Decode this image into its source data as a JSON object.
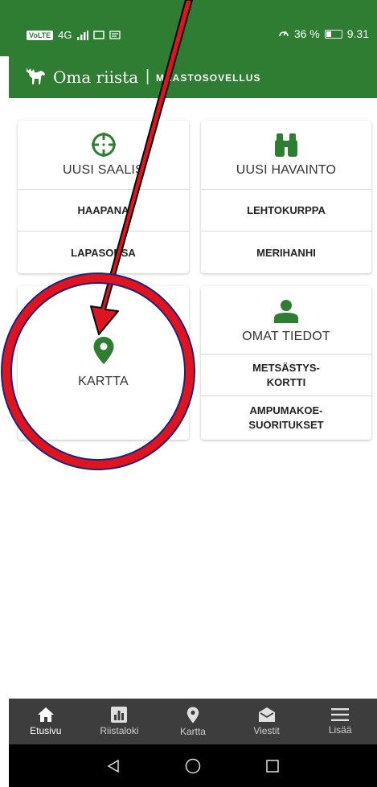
{
  "status": {
    "network": "4G",
    "battery": "36 %",
    "time": "9.31",
    "battery_level": 0.36
  },
  "app": {
    "title": "Oma riista",
    "subtitle": "MAASTOSOVELLUS"
  },
  "cards": {
    "saalis": {
      "title": "UUSI SAALIS",
      "items": [
        "HAAPANA",
        "LAPASORSA"
      ]
    },
    "havainto": {
      "title": "UUSI HAVAINTO",
      "items": [
        "LEHTOKURPPA",
        "MERIHANHI"
      ]
    },
    "kartta": {
      "title": "KARTTA"
    },
    "omat": {
      "title": "OMAT TIEDOT",
      "items": [
        "METSÄSTYS-\nKORTTI",
        "AMPUMAKOE-\nSUORITUKSET"
      ]
    }
  },
  "bottom_nav": [
    {
      "label": "Etusivu",
      "icon": "home-icon"
    },
    {
      "label": "Riistaloki",
      "icon": "bar-chart-icon"
    },
    {
      "label": "Kartta",
      "icon": "map-pin-icon"
    },
    {
      "label": "Viestit",
      "icon": "mail-icon"
    },
    {
      "label": "Lisää",
      "icon": "menu-icon"
    }
  ],
  "colors": {
    "brand_green": "#2e7d32",
    "nav_bg": "#3d3d3d",
    "annotation_red": "#e0141e"
  }
}
